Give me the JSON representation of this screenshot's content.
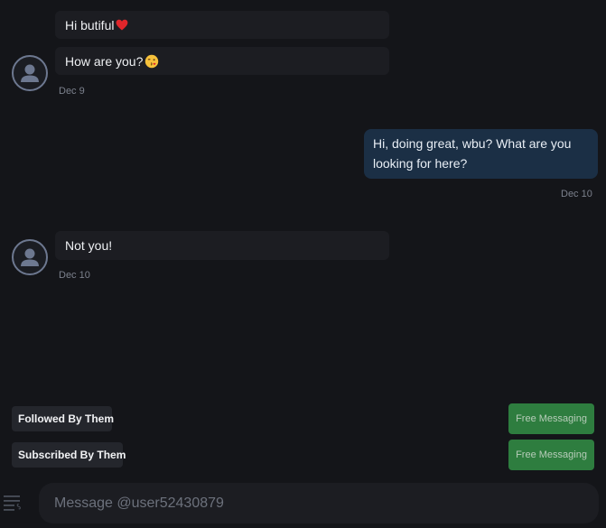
{
  "messages": [
    {
      "text": "Hi butiful"
    },
    {
      "text": "How are you?"
    },
    {
      "timestamp": "Dec 9"
    },
    {
      "text": "Hi, doing great, wbu? What are you looking for here?",
      "timestamp": "Dec 10"
    },
    {
      "text": "Not you!",
      "timestamp": "Dec 10"
    }
  ],
  "badges": [
    {
      "label": "Followed By Them",
      "action": "Free Messaging"
    },
    {
      "label": "Subscribed By Them",
      "action": "Free Messaging"
    }
  ],
  "composer": {
    "placeholder": "Message @user52430879"
  },
  "colors": {
    "background": "#141519",
    "incoming_bubble": "#1c1d22",
    "outgoing_bubble": "#1b2f45",
    "accent_green": "#2e7d3f"
  }
}
